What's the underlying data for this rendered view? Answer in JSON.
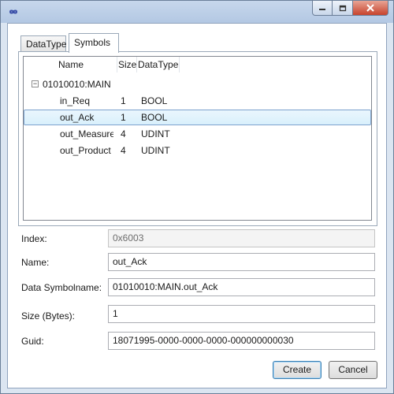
{
  "window": {
    "title": "",
    "icon": "infinity-icon"
  },
  "tabs": [
    {
      "label": "DataType",
      "selected": false
    },
    {
      "label": "Symbols",
      "selected": true
    }
  ],
  "tree": {
    "columns": [
      "Name",
      "Size",
      "DataType"
    ],
    "root": "01010010:MAIN",
    "rows": [
      {
        "name": "in_Req",
        "size": "1",
        "type": "BOOL"
      },
      {
        "name": "out_Ack",
        "size": "1",
        "type": "BOOL"
      },
      {
        "name": "out_Measure",
        "size": "4",
        "type": "UDINT"
      },
      {
        "name": "out_Product",
        "size": "4",
        "type": "UDINT"
      }
    ]
  },
  "form": {
    "index_label": "Index:",
    "index_value": "0x6003",
    "name_label": "Name:",
    "name_value": "out_Ack",
    "dsym_label": "Data Symbolname:",
    "dsym_value": "01010010:MAIN.out_Ack",
    "size_label": "Size (Bytes):",
    "size_value": "1",
    "guid_label": "Guid:",
    "guid_value": "18071995-0000-0000-0000-000000000030"
  },
  "buttons": {
    "create": "Create",
    "cancel": "Cancel"
  }
}
